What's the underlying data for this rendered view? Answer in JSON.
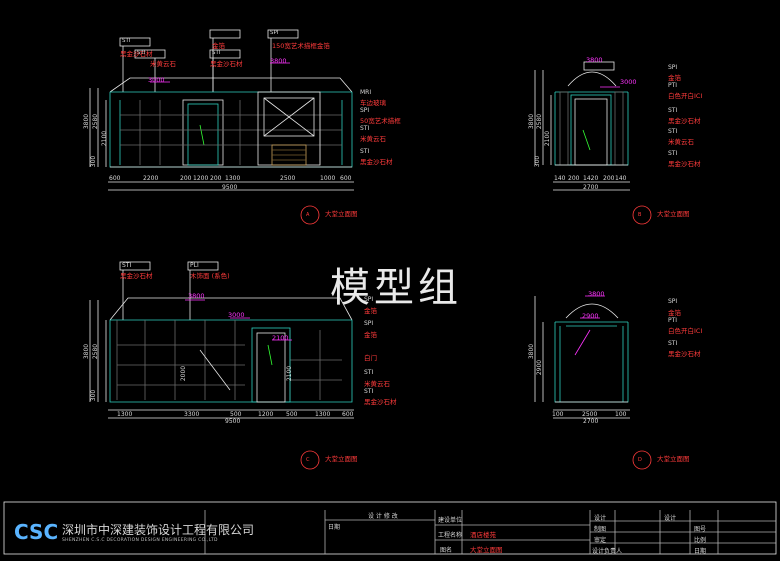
{
  "watermark": "模型组",
  "title_block": {
    "logo": "CSC",
    "company_cn": "深圳市中深建装饰设计工程有限公司",
    "company_en": "SHENZHEN C.S.C DECORATION DESIGN ENGINEERING CO.,LTD",
    "notes_heading": "设 计 修 改",
    "notes_date": "日期",
    "project_label": "工程名称",
    "project_name": "酒店楼苑",
    "drawing_label": "图名",
    "drawing_name": "大堂立面图",
    "designer": "设计",
    "checker": "制图",
    "approver": "审定",
    "lead": "设计负责人",
    "design2": "设计",
    "sheet_no": "图号",
    "scale": "比例",
    "date": "日期",
    "unit": "建设单位"
  },
  "views": {
    "a": {
      "title": "大堂立面图",
      "num": "A",
      "level_a": "3000",
      "level_b": "3800",
      "dims_bottom": [
        "600",
        "2200",
        "200",
        "1200",
        "200",
        "1300",
        "2500",
        "1000",
        "600"
      ],
      "total": "9500",
      "left_dims": [
        "3800",
        "2580",
        "2100",
        "300"
      ],
      "callouts": [
        "STI",
        "黑金沙石材",
        "STI",
        "米黄云石",
        "金箔",
        "STI",
        "黑金沙石材",
        "SPI",
        "150宽艺术描框金箔"
      ],
      "right_callouts": [
        "MRI",
        "车边玻璃",
        "SPI",
        "50宽艺术描框",
        "STI",
        "米黄云石",
        "STI",
        "黑金沙石材"
      ],
      "mid_dim": "2500"
    },
    "b": {
      "title": "大堂立面图",
      "num": "B",
      "level_a": "3000",
      "level_b": "3800",
      "dims_bottom": [
        "140",
        "200",
        "1420",
        "200",
        "140"
      ],
      "total": "2700",
      "left_dims": [
        "3800",
        "2580",
        "2100",
        "300"
      ],
      "right_callouts": [
        "SPI",
        "金箔",
        "PTI",
        "白色开白ICI",
        "STI",
        "黑金沙石材",
        "STI",
        "米黄云石",
        "STI",
        "黑金沙石材"
      ]
    },
    "c": {
      "title": "大堂立面图",
      "num": "C",
      "level_a": "3800",
      "level_b": "3000",
      "level_c": "2100",
      "dims_bottom": [
        "1300",
        "3300",
        "500",
        "1200",
        "500",
        "1300",
        "600"
      ],
      "total": "9500",
      "left_dims": [
        "3800",
        "2580",
        "2000",
        "2100",
        "300"
      ],
      "callouts": [
        "STI",
        "黑金沙石材",
        "PLI",
        "木饰面 (系色)"
      ],
      "right_callouts": [
        "SPI",
        "金箔",
        "SPI",
        "金箔",
        "白门",
        "STI",
        "米黄云石",
        "STI",
        "黑金沙石材"
      ]
    },
    "d": {
      "title": "大堂立面图",
      "num": "D",
      "level_a": "3800",
      "level_b": "2900",
      "dims_bottom": [
        "100",
        "2500",
        "100"
      ],
      "total": "2700",
      "left_dims": [
        "3800",
        "2900"
      ],
      "right_callouts": [
        "SPI",
        "金箔",
        "PTI",
        "白色开白ICI",
        "STI",
        "黑金沙石材"
      ]
    }
  }
}
